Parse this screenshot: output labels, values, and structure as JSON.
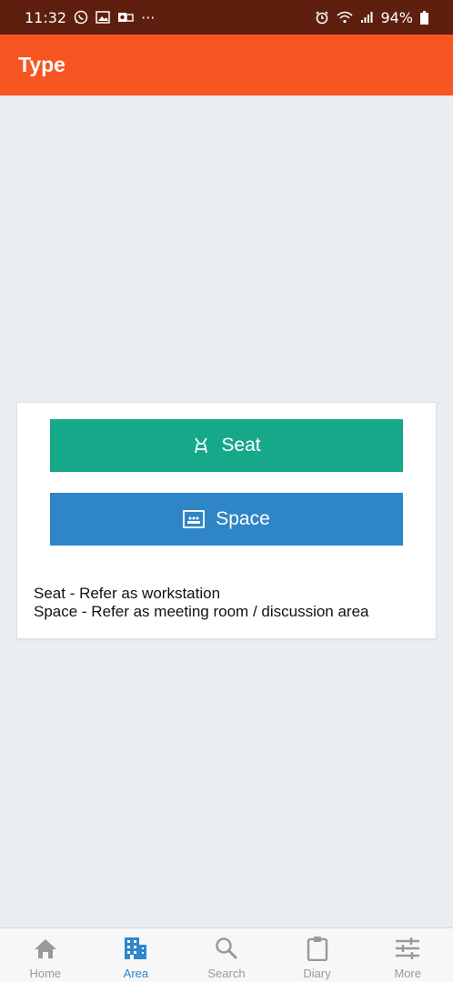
{
  "status_bar": {
    "time": "11:32",
    "more": "···",
    "battery": "94%"
  },
  "app_bar": {
    "title": "Type"
  },
  "options": {
    "seat_label": "Seat",
    "space_label": "Space"
  },
  "description": {
    "line1": "Seat - Refer as workstation",
    "line2": "Space - Refer as meeting room / discussion area"
  },
  "bottom_nav": {
    "items": [
      {
        "label": "Home",
        "icon": "home-icon"
      },
      {
        "label": "Area",
        "icon": "building-icon"
      },
      {
        "label": "Search",
        "icon": "search-icon"
      },
      {
        "label": "Diary",
        "icon": "clipboard-icon"
      },
      {
        "label": "More",
        "icon": "sliders-icon"
      }
    ],
    "active": "Area"
  },
  "colors": {
    "status_bar": "#5e1f0e",
    "app_bar": "#f75522",
    "seat": "#17a88a",
    "space": "#2e86c6",
    "active_nav": "#2f86c9"
  }
}
